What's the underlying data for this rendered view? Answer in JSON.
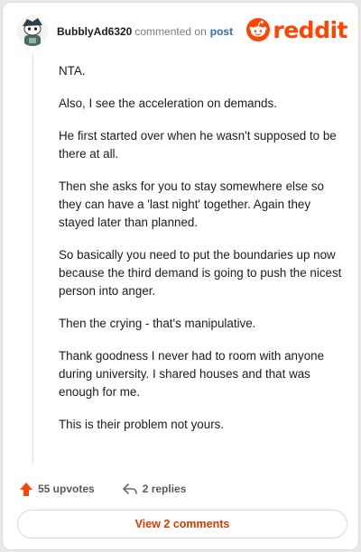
{
  "comment": {
    "username": "BubblyAd6320",
    "action_text": "commented on",
    "post_link_label": "post",
    "brand_name": "reddit",
    "paragraphs": [
      "NTA.",
      "Also, I see the acceleration on demands.",
      "He first started over when he wasn't supposed to be there at all.",
      "Then she asks for you to stay somewhere else so they can have a 'last night' together. Again they stayed later than planned.",
      "So basically you need to put the boundaries up now because the third demand is going to push the nicest person into anger.",
      "Then the crying - that's manipulative.",
      "Thank goodness I never had to room with anyone during university. I shared houses and that was enough for me.",
      "This is their problem not yours."
    ],
    "upvotes_label": "55 upvotes",
    "replies_label": "2 replies",
    "view_comments_label": "View 2 comments"
  },
  "icons": {
    "avatar": "snoo-avatar-icon",
    "brand": "reddit-logo-icon",
    "upvote": "upvote-arrow-icon",
    "reply": "reply-arrow-icon"
  },
  "colors": {
    "brand_orange": "#ff4500",
    "link_blue": "#2a6eb5",
    "view_comments_text": "#d93a00"
  }
}
